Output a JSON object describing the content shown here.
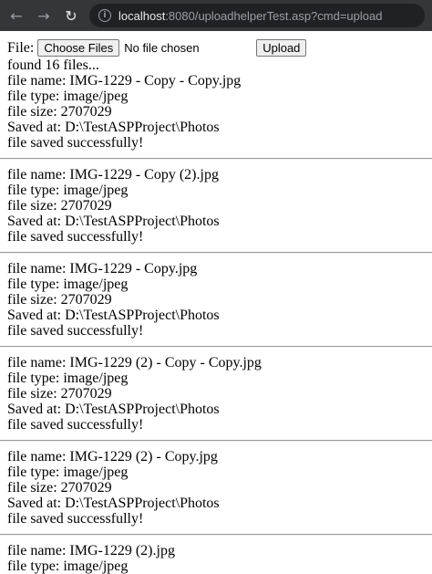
{
  "browser": {
    "url_host": "localhost",
    "url_path": ":8080/uploadhelperTest.asp?cmd=upload",
    "back_icon": "back-arrow-icon",
    "forward_icon": "forward-arrow-icon",
    "reload_icon": "reload-icon",
    "info_icon": "info-icon"
  },
  "form": {
    "file_label": "File:",
    "choose_button": "Choose Files",
    "no_file_text": "No file chosen",
    "upload_button": "Upload"
  },
  "summary": "found 16 files...",
  "files": [
    {
      "name": "file name: IMG-1229 - Copy - Copy.jpg",
      "type": "file type: image/jpeg",
      "size": "file size: 2707029",
      "saved": "Saved at: D:\\TestASPProject\\Photos",
      "status": "file saved successfully!"
    },
    {
      "name": "file name: IMG-1229 - Copy (2).jpg",
      "type": "file type: image/jpeg",
      "size": "file size: 2707029",
      "saved": "Saved at: D:\\TestASPProject\\Photos",
      "status": "file saved successfully!"
    },
    {
      "name": "file name: IMG-1229 - Copy.jpg",
      "type": "file type: image/jpeg",
      "size": "file size: 2707029",
      "saved": "Saved at: D:\\TestASPProject\\Photos",
      "status": "file saved successfully!"
    },
    {
      "name": "file name: IMG-1229 (2) - Copy - Copy.jpg",
      "type": "file type: image/jpeg",
      "size": "file size: 2707029",
      "saved": "Saved at: D:\\TestASPProject\\Photos",
      "status": "file saved successfully!"
    },
    {
      "name": "file name: IMG-1229 (2) - Copy.jpg",
      "type": "file type: image/jpeg",
      "size": "file size: 2707029",
      "saved": "Saved at: D:\\TestASPProject\\Photos",
      "status": "file saved successfully!"
    },
    {
      "name": "file name: IMG-1229 (2).jpg",
      "type": "file type: image/jpeg"
    }
  ]
}
